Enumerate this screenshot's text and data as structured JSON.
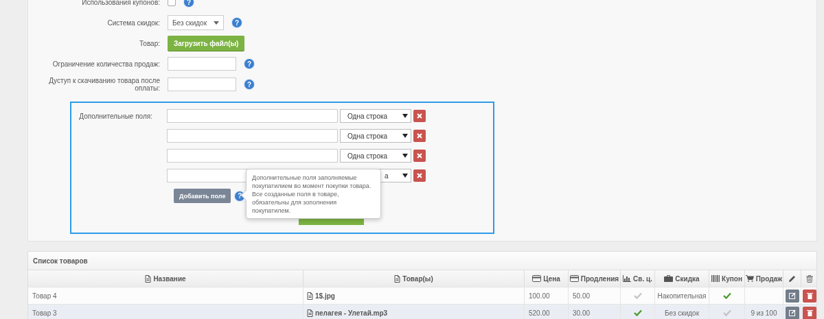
{
  "form": {
    "rows": [
      {
        "kind": "checkbox",
        "label": "Использования купонов:",
        "checked": false,
        "help": "?"
      },
      {
        "kind": "select",
        "label": "Система скидок:",
        "value": "Без скидок",
        "help": "?"
      },
      {
        "kind": "button",
        "label": "Товар:",
        "button": "Загрузить файл(ы)"
      },
      {
        "kind": "input",
        "label": "Ограничение количества продаж:",
        "help": "?"
      },
      {
        "kind": "input",
        "label": "Дуступ к скачиванию товара после оплаты:",
        "help": "?"
      }
    ],
    "extra_fields": {
      "label": "Дополнительные поля:",
      "highlighted": true,
      "fields": [
        {
          "type": "Одна строка",
          "partial": false
        },
        {
          "type": "Одна строка",
          "partial": false
        },
        {
          "type": "Одна строка",
          "partial": false
        },
        {
          "type": "а",
          "partial": true
        }
      ],
      "add_button": "Добавить поле",
      "add_help": "?",
      "tooltip": "Дополнительные поля заполняемые покупатилием во момент покупки товара. Все созданные поля в товаре, обязательны для зополнения покупатилем."
    }
  },
  "products": {
    "title": "Список товаров",
    "columns": [
      "Название",
      "Товар(ы)",
      "Цена",
      "Продления",
      "Св. ц.",
      "Скидка",
      "Купон",
      "Продаж"
    ],
    "rows": [
      {
        "name": "Товар 4",
        "file": "1$.jpg",
        "price": "100.00",
        "renewal": "50.00",
        "free_price": false,
        "discount": "Накопительная",
        "coupon": true,
        "selected": false
      },
      {
        "name": "Товар 3",
        "file": "пелагея - Улетай.mp3",
        "price": "520.00",
        "renewal": "30.00",
        "free_price": true,
        "discount": "Без скидок",
        "coupon": false,
        "sales": "9 из 100",
        "selected": true
      }
    ]
  }
}
